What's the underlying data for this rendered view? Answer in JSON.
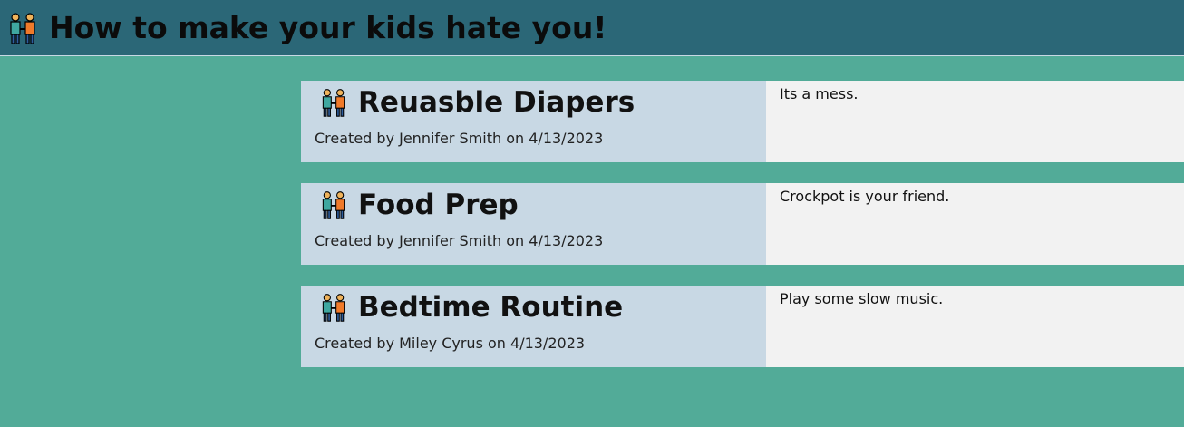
{
  "header": {
    "title": "How to make your kids hate you!",
    "icon": "people-holding-hands-icon"
  },
  "posts": [
    {
      "title": "Reuasble Diapers",
      "byline": "Created by Jennifer Smith on 4/13/2023",
      "body": "Its a mess."
    },
    {
      "title": "Food Prep",
      "byline": "Created by Jennifer Smith on 4/13/2023",
      "body": "Crockpot is your friend."
    },
    {
      "title": "Bedtime Routine",
      "byline": "Created by Miley Cyrus on 4/13/2023",
      "body": "Play some slow music."
    }
  ],
  "colors": {
    "page_background": "#52ab98",
    "header_background": "#2b6777",
    "card_left": "#c8d8e4",
    "card_right": "#f2f2f2"
  }
}
